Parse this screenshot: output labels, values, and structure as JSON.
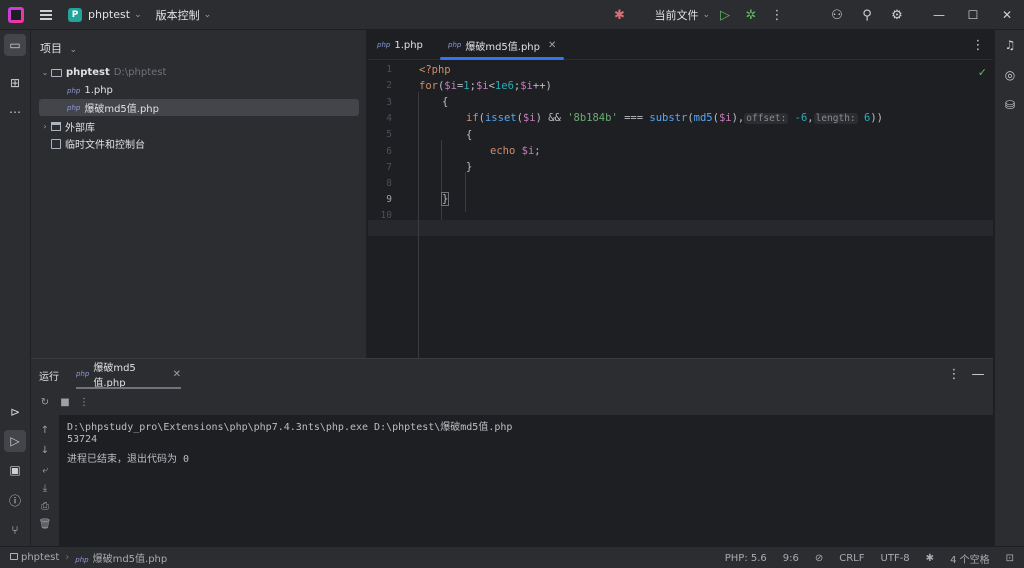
{
  "titlebar": {
    "project_badge": "P",
    "project_name": "phptest",
    "vcs_label": "版本控制",
    "run_config": "当前文件"
  },
  "project_panel": {
    "title": "项目",
    "root_name": "phptest",
    "root_path": "D:\\phptest",
    "files": [
      "1.php",
      "爆破md5值.php"
    ],
    "external_libs": "外部库",
    "scratches": "临时文件和控制台",
    "php_icon_text": "php"
  },
  "editor": {
    "tabs": [
      {
        "label": "1.php",
        "active": false
      },
      {
        "label": "爆破md5值.php",
        "active": true
      }
    ],
    "line_numbers": [
      "1",
      "2",
      "3",
      "4",
      "5",
      "6",
      "7",
      "8",
      "9",
      "10"
    ],
    "current_line": "9",
    "code": {
      "l1": "<?php",
      "l2_kw": "for",
      "l2_rest_a": "(",
      "l2_var1": "$i",
      "l2_eq": "=",
      "l2_num1": "1",
      "l2_semi": ";",
      "l2_var2": "$i",
      "l2_lt": "<",
      "l2_num2": "1e6",
      "l2_semi2": ";",
      "l2_var3": "$i",
      "l2_end": "++)",
      "l3": "{",
      "l4_kw": "if",
      "l4_a": "(",
      "l4_fn1": "isset",
      "l4_b": "(",
      "l4_var": "$i",
      "l4_c": ") && ",
      "l4_str": "'8b184b'",
      "l4_d": " === ",
      "l4_fn2": "substr",
      "l4_e": "(",
      "l4_fn3": "md5",
      "l4_f": "(",
      "l4_var2": "$i",
      "l4_g": "),",
      "l4_hint1": "offset:",
      "l4_num1": "-6",
      "l4_h": ",",
      "l4_hint2": "length:",
      "l4_num2": "6",
      "l4_i": "))",
      "l5": "{",
      "l6_kw": "echo",
      "l6_var": "$i",
      "l6_end": ";",
      "l7": "}",
      "l9": "}"
    }
  },
  "run_panel": {
    "title": "运行",
    "tab_label": "爆破md5值.php",
    "output": [
      "D:\\phpstudy_pro\\Extensions\\php\\php7.4.3nts\\php.exe D:\\phptest\\爆破md5值.php",
      "53724",
      "进程已结束，退出代码为 0"
    ]
  },
  "statusbar": {
    "breadcrumb_root": "phptest",
    "breadcrumb_file": "爆破md5值.php",
    "php_version": "PHP: 5.6",
    "cursor_pos": "9:6",
    "line_ending": "CRLF",
    "encoding": "UTF-8",
    "indent": "4 个空格"
  },
  "colors": {
    "accent": "#3574f0",
    "background": "#1e1f22",
    "panel": "#2b2d30"
  }
}
